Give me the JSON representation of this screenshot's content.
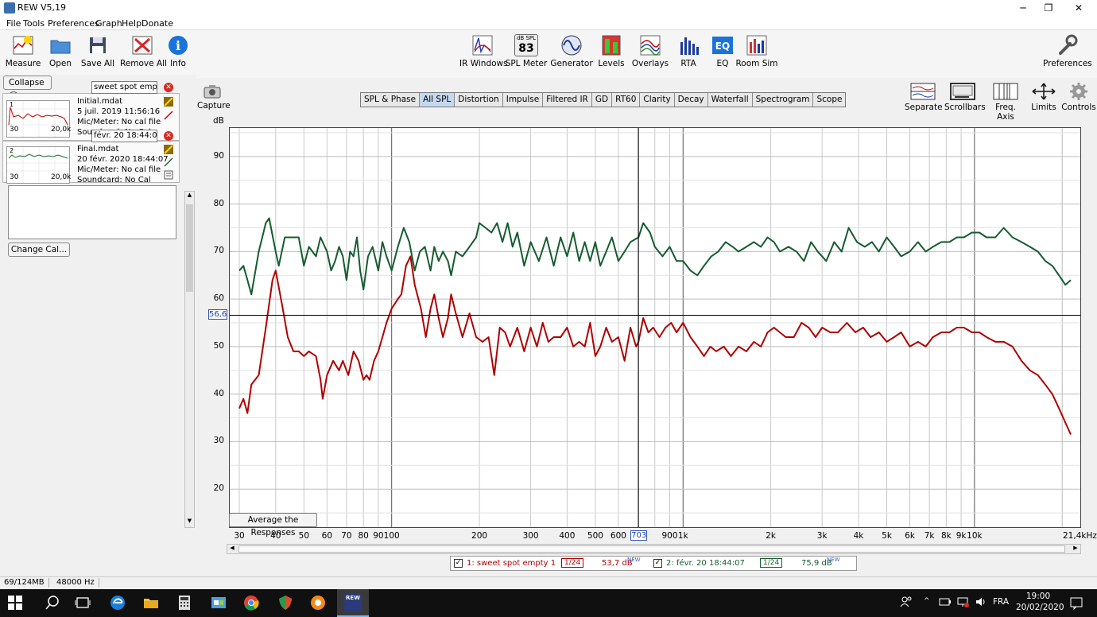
{
  "window": {
    "title": "REW V5,19",
    "minimize": "─",
    "maximize": "❐",
    "close": "✕"
  },
  "menu": [
    "File",
    "Tools",
    "Preferences",
    "Graph",
    "Help",
    "Donate"
  ],
  "toolbar_left": [
    "Measure",
    "Open",
    "Save All",
    "Remove All",
    "Info"
  ],
  "toolbar_center": [
    "IR Windows",
    "SPL Meter",
    "Generator",
    "Levels",
    "Overlays",
    "RTA",
    "EQ",
    "Room Sim"
  ],
  "spl_meter": {
    "unit": "dB SPL",
    "value": "83"
  },
  "toolbar_right": "Preferences",
  "left_panel": {
    "collapse": "Collapse",
    "capture": "Capture",
    "measurements": [
      {
        "index": "1",
        "name": "sweet spot empty 1",
        "file": "Initial.mdat",
        "date": "5 juil. 2019 11:56:16",
        "mic": "Mic/Meter: No cal file",
        "soundcard": "Soundcard: No Cal",
        "thumb_start": "30",
        "thumb_end": "20,0k",
        "color": "#c00000"
      },
      {
        "index": "2",
        "name": "févr. 20 18:44:07",
        "file": "Final.mdat",
        "date": "20 févr. 2020 18:44:07",
        "mic": "Mic/Meter: No cal file",
        "soundcard": "Soundcard: No Cal",
        "thumb_start": "30",
        "thumb_end": "20,0k",
        "color": "#1f6b35"
      }
    ],
    "change_cal": "Change Cal..."
  },
  "tabs": [
    "SPL & Phase",
    "All SPL",
    "Distortion",
    "Impulse",
    "Filtered IR",
    "GD",
    "RT60",
    "Clarity",
    "Decay",
    "Waterfall",
    "Spectrogram",
    "Scope"
  ],
  "active_tab": "All SPL",
  "right_controls": [
    "Separate",
    "Scrollbars",
    "Freq. Axis",
    "Limits",
    "Controls"
  ],
  "graph": {
    "y_unit": "dB",
    "cursor_x": "703",
    "cursor_y": "56,6",
    "average_button": "Average the Responses",
    "x_end_label": "21,4kHz"
  },
  "chart_data": {
    "type": "line",
    "xscale": "log",
    "xlim": [
      30,
      21400
    ],
    "ylim": [
      12,
      96
    ],
    "y_ticks": [
      20,
      30,
      40,
      50,
      60,
      70,
      80,
      90
    ],
    "x_ticks": [
      {
        "v": 30,
        "t": "30"
      },
      {
        "v": 40,
        "t": "40"
      },
      {
        "v": 50,
        "t": "50"
      },
      {
        "v": 60,
        "t": "60"
      },
      {
        "v": 70,
        "t": "70"
      },
      {
        "v": 80,
        "t": "80"
      },
      {
        "v": 90,
        "t": "90"
      },
      {
        "v": 100,
        "t": "100"
      },
      {
        "v": 200,
        "t": "200"
      },
      {
        "v": 300,
        "t": "300"
      },
      {
        "v": 400,
        "t": "400"
      },
      {
        "v": 500,
        "t": "500"
      },
      {
        "v": 600,
        "t": "600"
      },
      {
        "v": 900,
        "t": "900"
      },
      {
        "v": 1000,
        "t": "1k"
      },
      {
        "v": 2000,
        "t": "2k"
      },
      {
        "v": 3000,
        "t": "3k"
      },
      {
        "v": 4000,
        "t": "4k"
      },
      {
        "v": 5000,
        "t": "5k"
      },
      {
        "v": 6000,
        "t": "6k"
      },
      {
        "v": 7000,
        "t": "7k"
      },
      {
        "v": 8000,
        "t": "8k"
      },
      {
        "v": 9000,
        "t": "9k"
      },
      {
        "v": 10000,
        "t": "10k"
      }
    ],
    "cursor": {
      "x": 703,
      "y": 56.6
    },
    "series": [
      {
        "name": "1: sweet spot empty 1",
        "color": "#b00000",
        "points": [
          [
            30,
            37
          ],
          [
            31,
            39
          ],
          [
            32,
            36
          ],
          [
            33,
            42
          ],
          [
            35,
            44
          ],
          [
            37,
            54
          ],
          [
            39,
            64
          ],
          [
            40,
            66
          ],
          [
            42,
            59
          ],
          [
            44,
            52
          ],
          [
            46,
            49
          ],
          [
            48,
            49
          ],
          [
            50,
            48
          ],
          [
            52,
            49
          ],
          [
            55,
            48
          ],
          [
            57,
            43
          ],
          [
            58,
            39
          ],
          [
            60,
            44
          ],
          [
            63,
            47
          ],
          [
            66,
            45
          ],
          [
            68,
            47
          ],
          [
            71,
            44
          ],
          [
            74,
            49
          ],
          [
            77,
            47
          ],
          [
            80,
            43
          ],
          [
            82,
            44
          ],
          [
            84,
            43
          ],
          [
            87,
            47
          ],
          [
            90,
            49
          ],
          [
            93,
            52
          ],
          [
            96,
            55
          ],
          [
            100,
            58
          ],
          [
            105,
            60
          ],
          [
            108,
            61
          ],
          [
            112,
            67
          ],
          [
            116,
            69
          ],
          [
            120,
            63
          ],
          [
            126,
            58
          ],
          [
            131,
            52
          ],
          [
            136,
            58
          ],
          [
            140,
            61
          ],
          [
            145,
            56
          ],
          [
            150,
            52
          ],
          [
            156,
            56
          ],
          [
            160,
            61
          ],
          [
            166,
            57
          ],
          [
            175,
            52
          ],
          [
            185,
            57
          ],
          [
            195,
            52
          ],
          [
            205,
            51
          ],
          [
            215,
            52
          ],
          [
            225,
            44
          ],
          [
            235,
            54
          ],
          [
            245,
            53
          ],
          [
            255,
            50
          ],
          [
            270,
            54
          ],
          [
            285,
            49
          ],
          [
            300,
            54
          ],
          [
            315,
            50
          ],
          [
            330,
            55
          ],
          [
            345,
            51
          ],
          [
            360,
            52
          ],
          [
            380,
            52
          ],
          [
            400,
            54
          ],
          [
            420,
            50
          ],
          [
            440,
            51
          ],
          [
            460,
            50
          ],
          [
            480,
            55
          ],
          [
            500,
            48
          ],
          [
            520,
            50
          ],
          [
            545,
            54
          ],
          [
            570,
            51
          ],
          [
            600,
            52
          ],
          [
            630,
            47
          ],
          [
            660,
            54
          ],
          [
            690,
            50
          ],
          [
            703,
            51
          ],
          [
            730,
            56
          ],
          [
            760,
            53
          ],
          [
            790,
            54
          ],
          [
            830,
            52
          ],
          [
            870,
            54
          ],
          [
            910,
            55
          ],
          [
            950,
            53
          ],
          [
            1000,
            55
          ],
          [
            1060,
            52
          ],
          [
            1120,
            50
          ],
          [
            1180,
            48
          ],
          [
            1240,
            50
          ],
          [
            1300,
            49
          ],
          [
            1380,
            50
          ],
          [
            1460,
            48
          ],
          [
            1550,
            50
          ],
          [
            1650,
            49
          ],
          [
            1750,
            51
          ],
          [
            1850,
            50
          ],
          [
            1950,
            53
          ],
          [
            2050,
            54
          ],
          [
            2150,
            53
          ],
          [
            2250,
            52
          ],
          [
            2400,
            52
          ],
          [
            2550,
            55
          ],
          [
            2700,
            54
          ],
          [
            2850,
            52
          ],
          [
            3000,
            54
          ],
          [
            3200,
            53
          ],
          [
            3400,
            53
          ],
          [
            3650,
            55
          ],
          [
            3900,
            53
          ],
          [
            4150,
            54
          ],
          [
            4400,
            52
          ],
          [
            4700,
            53
          ],
          [
            5000,
            51
          ],
          [
            5300,
            52
          ],
          [
            5600,
            53
          ],
          [
            6000,
            50
          ],
          [
            6400,
            51
          ],
          [
            6800,
            50
          ],
          [
            7200,
            52
          ],
          [
            7700,
            53
          ],
          [
            8200,
            53
          ],
          [
            8700,
            54
          ],
          [
            9200,
            54
          ],
          [
            9800,
            53
          ],
          [
            10400,
            53
          ],
          [
            11000,
            52
          ],
          [
            11800,
            51
          ],
          [
            12600,
            51
          ],
          [
            13500,
            50
          ],
          [
            14500,
            47
          ],
          [
            15500,
            45
          ],
          [
            16500,
            44
          ],
          [
            17500,
            42
          ],
          [
            18500,
            40
          ],
          [
            19500,
            37
          ],
          [
            20500,
            34
          ],
          [
            21400,
            31.5
          ]
        ]
      },
      {
        "name": "2: févr. 20 18:44:07",
        "color": "#145c2e",
        "points": [
          [
            30,
            66
          ],
          [
            31,
            67
          ],
          [
            32,
            64
          ],
          [
            33,
            61
          ],
          [
            35,
            70
          ],
          [
            37,
            76
          ],
          [
            38,
            77
          ],
          [
            40,
            70
          ],
          [
            41,
            67
          ],
          [
            43,
            73
          ],
          [
            45,
            73
          ],
          [
            48,
            73
          ],
          [
            50,
            67
          ],
          [
            52,
            71
          ],
          [
            55,
            69
          ],
          [
            57,
            73
          ],
          [
            60,
            70
          ],
          [
            62,
            66
          ],
          [
            64,
            68
          ],
          [
            66,
            71
          ],
          [
            68,
            69
          ],
          [
            70,
            64
          ],
          [
            72,
            70
          ],
          [
            74,
            69
          ],
          [
            76,
            73
          ],
          [
            78,
            66
          ],
          [
            80,
            62
          ],
          [
            83,
            69
          ],
          [
            86,
            71
          ],
          [
            90,
            66
          ],
          [
            93,
            72
          ],
          [
            96,
            69
          ],
          [
            100,
            66
          ],
          [
            105,
            71
          ],
          [
            110,
            75
          ],
          [
            115,
            72
          ],
          [
            120,
            66
          ],
          [
            125,
            70
          ],
          [
            130,
            71
          ],
          [
            136,
            66
          ],
          [
            140,
            71
          ],
          [
            145,
            68
          ],
          [
            150,
            70
          ],
          [
            156,
            68
          ],
          [
            160,
            65
          ],
          [
            166,
            70
          ],
          [
            175,
            69
          ],
          [
            185,
            71
          ],
          [
            195,
            73
          ],
          [
            200,
            76
          ],
          [
            210,
            75
          ],
          [
            220,
            74
          ],
          [
            230,
            76
          ],
          [
            240,
            72
          ],
          [
            250,
            76
          ],
          [
            260,
            71
          ],
          [
            270,
            74
          ],
          [
            285,
            67
          ],
          [
            300,
            72
          ],
          [
            320,
            68
          ],
          [
            340,
            73
          ],
          [
            360,
            67
          ],
          [
            380,
            73
          ],
          [
            400,
            69
          ],
          [
            420,
            74
          ],
          [
            440,
            68
          ],
          [
            460,
            72
          ],
          [
            480,
            68
          ],
          [
            500,
            72
          ],
          [
            520,
            67
          ],
          [
            545,
            70
          ],
          [
            570,
            73
          ],
          [
            600,
            68
          ],
          [
            630,
            70
          ],
          [
            660,
            72
          ],
          [
            703,
            73
          ],
          [
            730,
            76
          ],
          [
            770,
            74
          ],
          [
            800,
            71
          ],
          [
            850,
            69
          ],
          [
            900,
            71
          ],
          [
            950,
            68
          ],
          [
            1000,
            68
          ],
          [
            1060,
            66
          ],
          [
            1120,
            65
          ],
          [
            1180,
            67
          ],
          [
            1250,
            69
          ],
          [
            1320,
            70
          ],
          [
            1400,
            72
          ],
          [
            1480,
            71
          ],
          [
            1550,
            70
          ],
          [
            1650,
            71
          ],
          [
            1750,
            72
          ],
          [
            1850,
            71
          ],
          [
            1950,
            73
          ],
          [
            2050,
            72
          ],
          [
            2150,
            70
          ],
          [
            2300,
            71
          ],
          [
            2450,
            70
          ],
          [
            2600,
            68
          ],
          [
            2750,
            72
          ],
          [
            2900,
            70
          ],
          [
            3100,
            68
          ],
          [
            3300,
            72
          ],
          [
            3500,
            70
          ],
          [
            3700,
            75
          ],
          [
            3950,
            72
          ],
          [
            4200,
            71
          ],
          [
            4450,
            72
          ],
          [
            4700,
            70
          ],
          [
            5000,
            73
          ],
          [
            5300,
            71
          ],
          [
            5600,
            69
          ],
          [
            6000,
            70
          ],
          [
            6400,
            72
          ],
          [
            6800,
            70
          ],
          [
            7200,
            71
          ],
          [
            7700,
            72
          ],
          [
            8200,
            72
          ],
          [
            8700,
            73
          ],
          [
            9200,
            73
          ],
          [
            9800,
            74
          ],
          [
            10400,
            74
          ],
          [
            11000,
            73
          ],
          [
            11800,
            73
          ],
          [
            12600,
            75
          ],
          [
            13500,
            73
          ],
          [
            14500,
            72
          ],
          [
            15500,
            71
          ],
          [
            16500,
            70
          ],
          [
            17500,
            68
          ],
          [
            18500,
            67
          ],
          [
            19500,
            65
          ],
          [
            20500,
            63
          ],
          [
            21400,
            64
          ]
        ]
      }
    ]
  },
  "legend": [
    {
      "name": "1: sweet spot empty 1",
      "smoothing": "1/24",
      "level": "53,7 dB",
      "tag": "NEW",
      "color": "#b00000"
    },
    {
      "name": "2: févr. 20 18:44:07",
      "smoothing": "1/24",
      "level": "75,9 dB",
      "tag": "NEW",
      "color": "#145c2e"
    }
  ],
  "status": {
    "memory": "69/124MB",
    "rate": "48000 Hz"
  },
  "taskbar": {
    "lang": "FRA",
    "time": "19:00",
    "date": "20/02/2020",
    "rew": "REW"
  }
}
